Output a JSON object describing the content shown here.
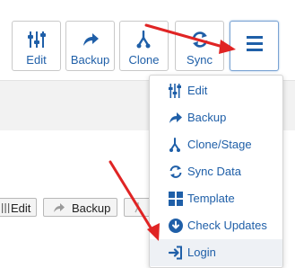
{
  "toolbar": {
    "edit_label": "Edit",
    "backup_label": "Backup",
    "clone_label": "Clone",
    "sync_label": "Sync"
  },
  "dropdown": {
    "items": [
      {
        "label": "Edit",
        "icon": "sliders-icon"
      },
      {
        "label": "Backup",
        "icon": "share-arrow-icon"
      },
      {
        "label": "Clone/Stage",
        "icon": "fork-icon"
      },
      {
        "label": "Sync Data",
        "icon": "sync-icon"
      },
      {
        "label": "Template",
        "icon": "grid-icon"
      },
      {
        "label": "Check Updates",
        "icon": "download-circle-icon"
      },
      {
        "label": "Login",
        "icon": "login-icon"
      }
    ]
  },
  "row_actions": {
    "edit_label": "Edit",
    "backup_label": "Backup"
  },
  "colors": {
    "accent": "#1f5fa8",
    "annotation_arrow": "#e02424"
  }
}
